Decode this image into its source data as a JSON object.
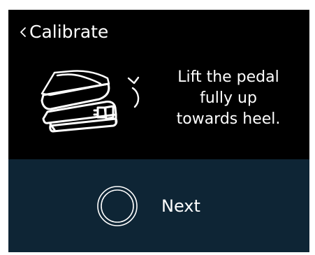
{
  "screen": {
    "title": "Calibrate",
    "back_icon": "chevron-left-icon",
    "instruction": "Lift the pedal\nfully up\ntowards heel.",
    "illustration_icon": "expression-pedal-heel-up-icon",
    "next_label": "Next",
    "next_icon": "ring-button-icon"
  },
  "colors": {
    "background": "#000000",
    "footer": "#0e2535",
    "text": "#ffffff",
    "frame": "#ffffff"
  }
}
